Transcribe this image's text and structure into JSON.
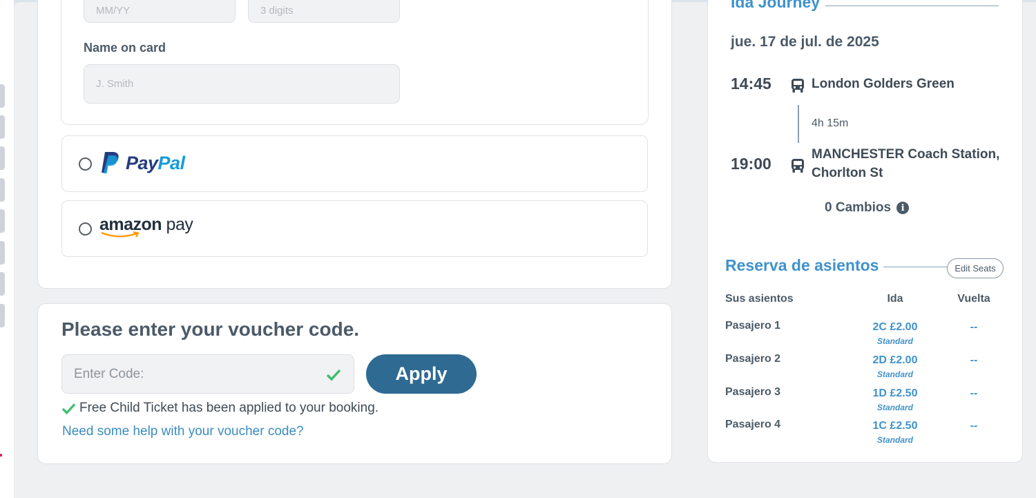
{
  "payment": {
    "expiry_placeholder": "MM/YY",
    "cvv_placeholder": "3 digits",
    "name_label": "Name on card",
    "name_placeholder": "J. Smith",
    "paypal_text": {
      "pay": "Pay",
      "pal": "Pal"
    },
    "amazon_text": {
      "amazon": "amazon",
      "pay": "pay"
    }
  },
  "voucher": {
    "title": "Please enter your voucher code.",
    "input_placeholder": "Enter Code:",
    "apply_label": "Apply",
    "applied_message": "Free Child Ticket has been applied to your booking.",
    "help_link": "Need some help with your voucher code?"
  },
  "journey": {
    "title": "Ida Journey",
    "date": "jue. 17 de jul. de 2025",
    "departure_time": "14:45",
    "departure_stop": "London Golders Green",
    "duration": "4h 15m",
    "arrival_time": "19:00",
    "arrival_stop_line1": "MANCHESTER Coach Station,",
    "arrival_stop_line2": "Chorlton St",
    "changes": "0 Cambios"
  },
  "seats": {
    "title": "Reserva de asientos",
    "edit_label": "Edit Seats",
    "headers": {
      "seats": "Sus asientos",
      "outbound": "Ida",
      "return": "Vuelta"
    },
    "passengers": [
      {
        "name": "Pasajero 1",
        "outbound": "2C £2.00",
        "class": "Standard",
        "return": "--"
      },
      {
        "name": "Pasajero 2",
        "outbound": "2D £2.00",
        "class": "Standard",
        "return": "--"
      },
      {
        "name": "Pasajero 3",
        "outbound": "1D £2.50",
        "class": "Standard",
        "return": "--"
      },
      {
        "name": "Pasajero 4",
        "outbound": "1C £2.50",
        "class": "Standard",
        "return": "--"
      }
    ]
  },
  "colors": {
    "accent": "#3f92cc",
    "button": "#2f6a93",
    "success": "#3fbf6f",
    "paypal_dark": "#253b80",
    "paypal_light": "#179bd7",
    "amazon_orange": "#ff9900"
  }
}
